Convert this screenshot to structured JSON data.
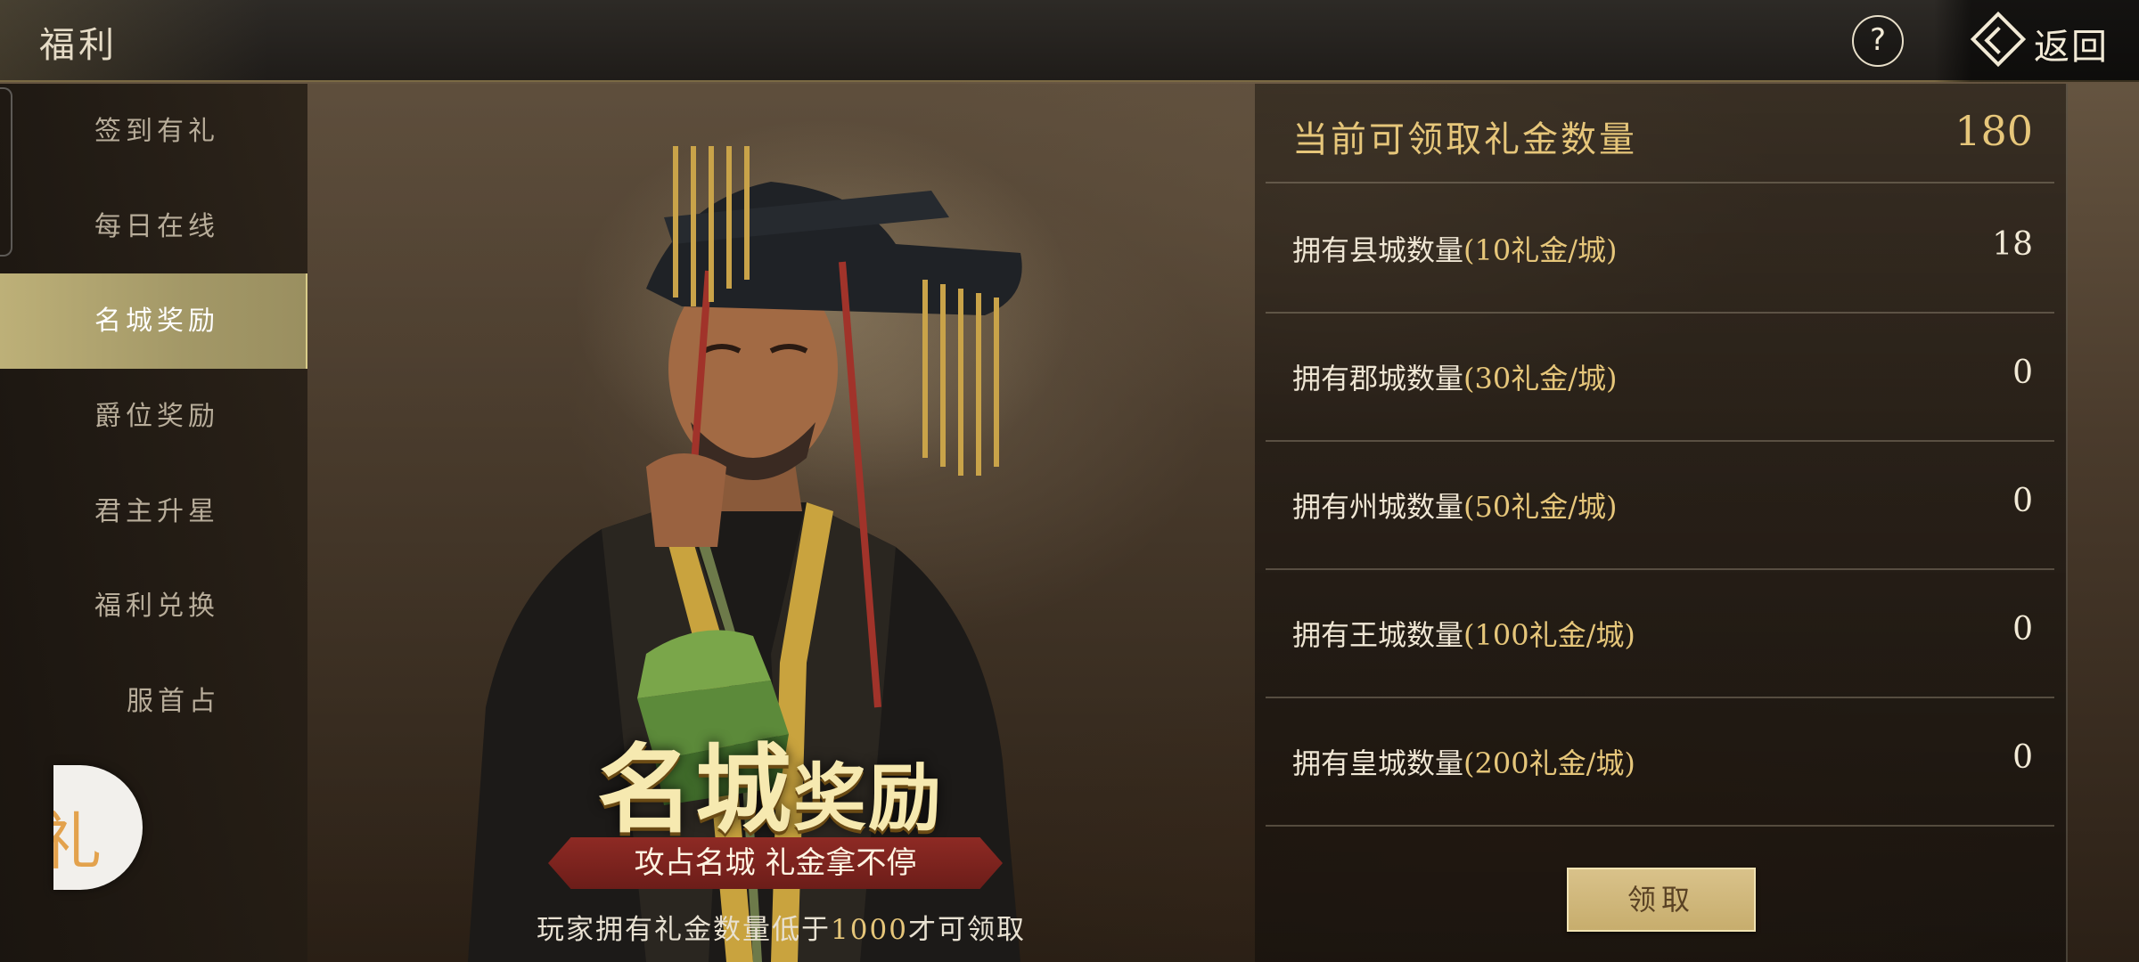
{
  "header": {
    "title": "福利",
    "help_label": "?",
    "back_label": "返回"
  },
  "sidebar": {
    "items": [
      {
        "label": "签到有礼"
      },
      {
        "label": "每日在线"
      },
      {
        "label": "名城奖励",
        "active": true
      },
      {
        "label": "爵位奖励"
      },
      {
        "label": "君主升星"
      },
      {
        "label": "福利兑换"
      },
      {
        "label": "服首占"
      }
    ],
    "bubble_label": "礼"
  },
  "promo": {
    "title_main": "名城",
    "title_small": "奖励",
    "ribbon": "攻占名城 礼金拿不停",
    "note_prefix": "玩家拥有礼金数量低于",
    "note_number": "1000",
    "note_suffix": "才可领取"
  },
  "rewards": {
    "header_label": "当前可领取礼金数量",
    "header_value": "180",
    "rows": [
      {
        "label": "拥有县城数量",
        "rate": "(10礼金/城)",
        "value": "18"
      },
      {
        "label": "拥有郡城数量",
        "rate": "(30礼金/城)",
        "value": "0"
      },
      {
        "label": "拥有州城数量",
        "rate": "(50礼金/城)",
        "value": "0"
      },
      {
        "label": "拥有王城数量",
        "rate": "(100礼金/城)",
        "value": "0"
      },
      {
        "label": "拥有皇城数量",
        "rate": "(200礼金/城)",
        "value": "0"
      }
    ],
    "claim_label": "领取"
  },
  "colors": {
    "gold_accent": "#e6c67a",
    "active_tab": "#bdb078",
    "ribbon_red": "#8e2a24"
  }
}
